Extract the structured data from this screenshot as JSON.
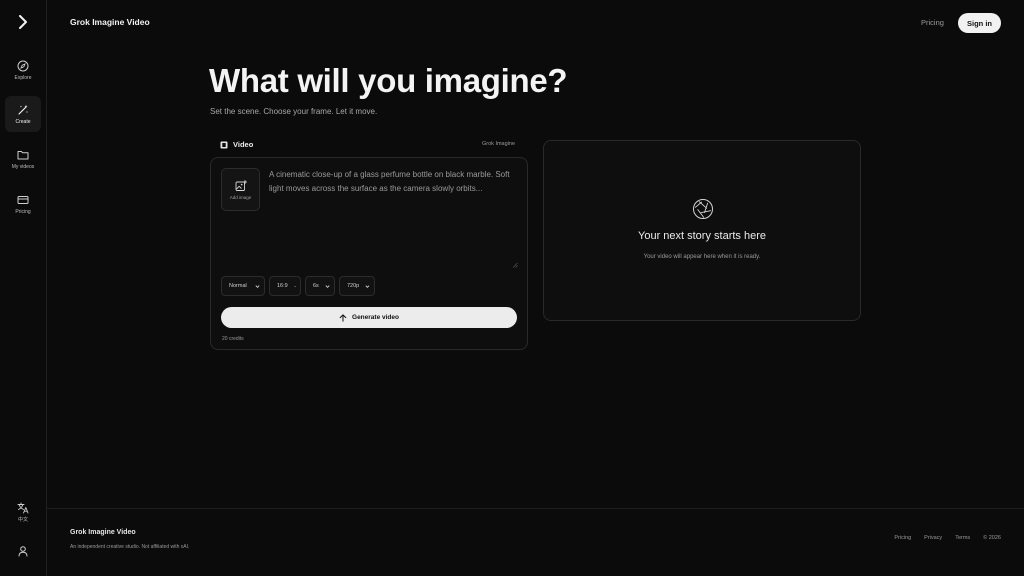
{
  "sidebar": {
    "items": [
      {
        "label": "Explore"
      },
      {
        "label": "Create"
      },
      {
        "label": "My videos"
      },
      {
        "label": "Pricing"
      }
    ],
    "language_label": "中文"
  },
  "header": {
    "brand": "Grok Imagine Video",
    "pricing_label": "Pricing",
    "signin_label": "Sign in"
  },
  "hero": {
    "title": "What will you imagine?",
    "subtitle": "Set the scene. Choose your frame. Let it move."
  },
  "composer": {
    "tab_label": "Video",
    "model_label": "Grok Imagine",
    "add_image_label": "Add image",
    "prompt_placeholder": "A cinematic close-up of a glass perfume bottle on black marble. Soft light moves across the surface as the camera slowly orbits...",
    "mode": "Normal",
    "aspect": "16:9",
    "duration": "6s",
    "resolution": "720p",
    "generate_label": "Generate video",
    "credits": "20 credits"
  },
  "preview": {
    "title": "Your next story starts here",
    "subtitle": "Your video will appear here when it is ready."
  },
  "footer": {
    "brand": "Grok Imagine Video",
    "note": "An independent creative studio. Not affiliated with xAI.",
    "links": [
      "Pricing",
      "Privacy",
      "Terms"
    ],
    "copyright": "© 2026"
  }
}
